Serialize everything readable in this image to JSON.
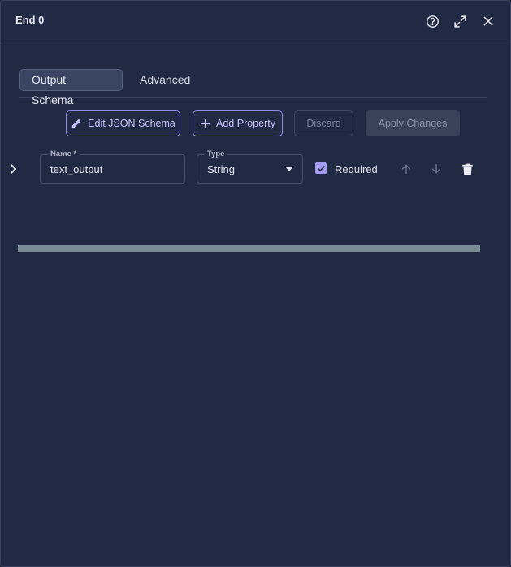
{
  "header": {
    "title": "End 0",
    "icons": [
      "help-icon",
      "expand-icon",
      "close-icon"
    ]
  },
  "tabs": [
    {
      "label": "Output Schema",
      "active": true
    },
    {
      "label": "Advanced",
      "active": false
    }
  ],
  "toolbar": {
    "edit_json_label": "Edit JSON Schema",
    "add_property_label": "Add Property",
    "discard_label": "Discard",
    "apply_label": "Apply Changes"
  },
  "property": {
    "name_label": "Name *",
    "name_value": "text_output",
    "type_label": "Type",
    "type_value": "String",
    "required_label": "Required",
    "required_checked": true
  },
  "colors": {
    "panel_bg": "#222943",
    "accent": "#8e88e6",
    "checkbox": "#a49cf2"
  }
}
